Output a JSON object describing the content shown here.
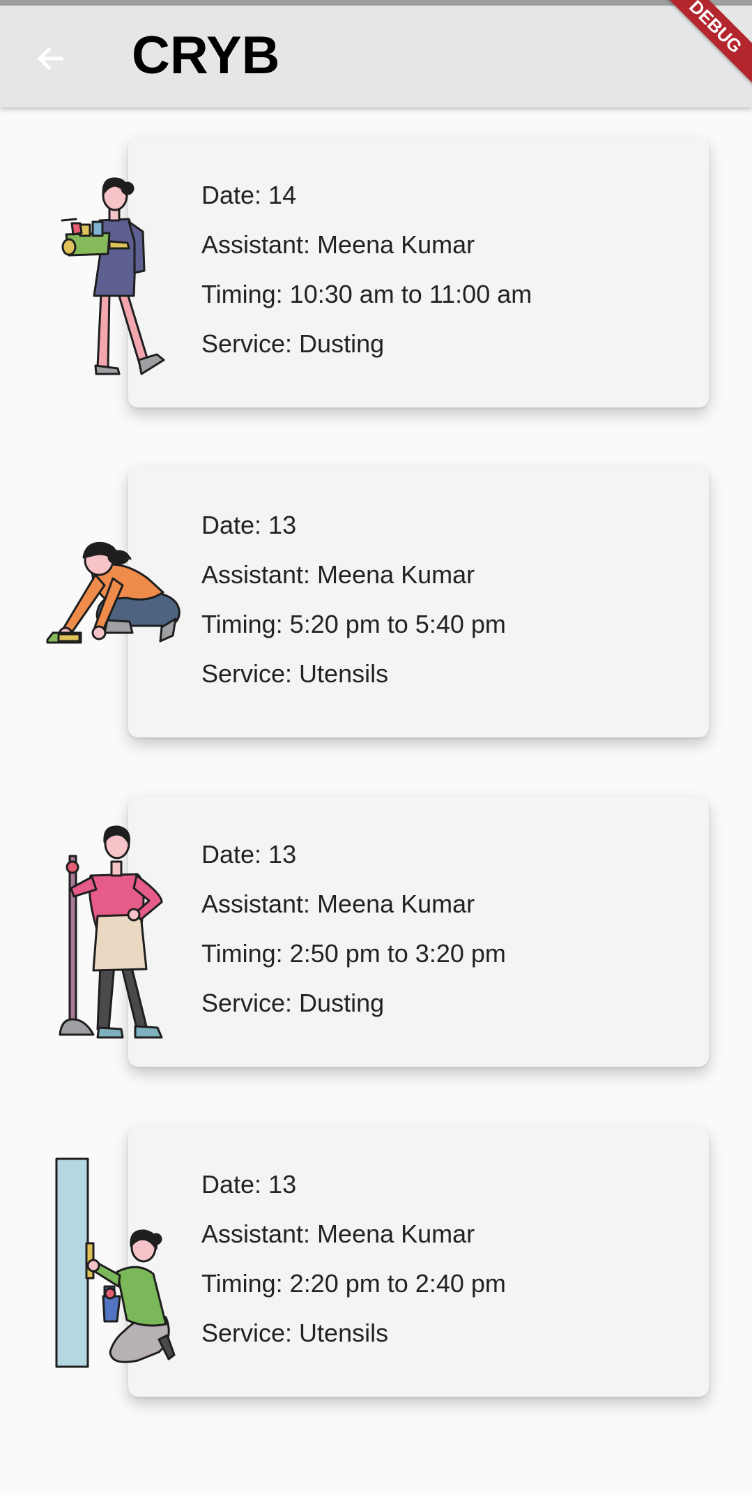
{
  "app_bar": {
    "title": "CRYB",
    "debug_label": "DEBUG"
  },
  "bookings": [
    {
      "date": "Date: 14",
      "assistant": "Assistant: Meena Kumar",
      "timing": "Timing: 10:30 am to 11:00 am",
      "service": "Service: Dusting",
      "illustration": "woman-holding-cleaning-basket-illustration"
    },
    {
      "date": "Date: 13",
      "assistant": "Assistant: Meena Kumar",
      "timing": "Timing: 5:20 pm to 5:40 pm",
      "service": "Service: Utensils",
      "illustration": "woman-scrubbing-floor-illustration"
    },
    {
      "date": "Date: 13",
      "assistant": "Assistant: Meena Kumar",
      "timing": "Timing: 2:50 pm to 3:20 pm",
      "service": "Service: Dusting",
      "illustration": "woman-with-mop-illustration"
    },
    {
      "date": "Date: 13",
      "assistant": "Assistant: Meena Kumar",
      "timing": "Timing: 2:20 pm to 2:40 pm",
      "service": "Service: Utensils",
      "illustration": "woman-cleaning-door-illustration"
    }
  ],
  "colors": {
    "app_bar": "#e6e6e6",
    "background": "#fafafa",
    "card": "#f4f4f4",
    "debug_banner": "#b3262d"
  }
}
